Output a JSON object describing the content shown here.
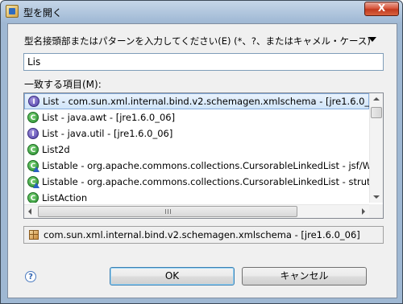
{
  "window": {
    "title": "型を開く",
    "close_glyph": "X"
  },
  "prompt": {
    "label": "型名接頭部またはパターンを入力してください(E) (*、?、またはキャメル・ケース)"
  },
  "search": {
    "value": "Lis",
    "placeholder": ""
  },
  "matches": {
    "label": "一致する項目(M):",
    "items": [
      {
        "text": "List - com.sun.xml.internal.bind.v2.schemagen.xmlschema - [jre1.6.0_06]",
        "icon": "interface-icon",
        "letter": "I",
        "selected": true
      },
      {
        "text": "List - java.awt - [jre1.6.0_06]",
        "icon": "class-icon",
        "letter": "C",
        "selected": false
      },
      {
        "text": "List - java.util - [jre1.6.0_06]",
        "icon": "interface-icon",
        "letter": "I",
        "selected": false
      },
      {
        "text": "List2d",
        "icon": "class-icon",
        "letter": "C",
        "selected": false
      },
      {
        "text": "Listable - org.apache.commons.collections.CursorableLinkedList - jsf/WEB-INF",
        "icon": "class-icon",
        "letter": "C",
        "selected": false
      },
      {
        "text": "Listable - org.apache.commons.collections.CursorableLinkedList - struts/WEB-INF",
        "icon": "class-icon",
        "letter": "C",
        "selected": false
      },
      {
        "text": "ListAction",
        "icon": "class-icon",
        "letter": "C",
        "selected": false
      }
    ]
  },
  "status": {
    "text": "com.sun.xml.internal.bind.v2.schemagen.xmlschema - [jre1.6.0_06]",
    "icon": "package-icon"
  },
  "buttons": {
    "help": "?",
    "ok": "OK",
    "cancel": "キャンセル"
  },
  "colors": {
    "selection": "#d1e5f9",
    "interface": "#4a3aa6",
    "class": "#238a2b"
  }
}
